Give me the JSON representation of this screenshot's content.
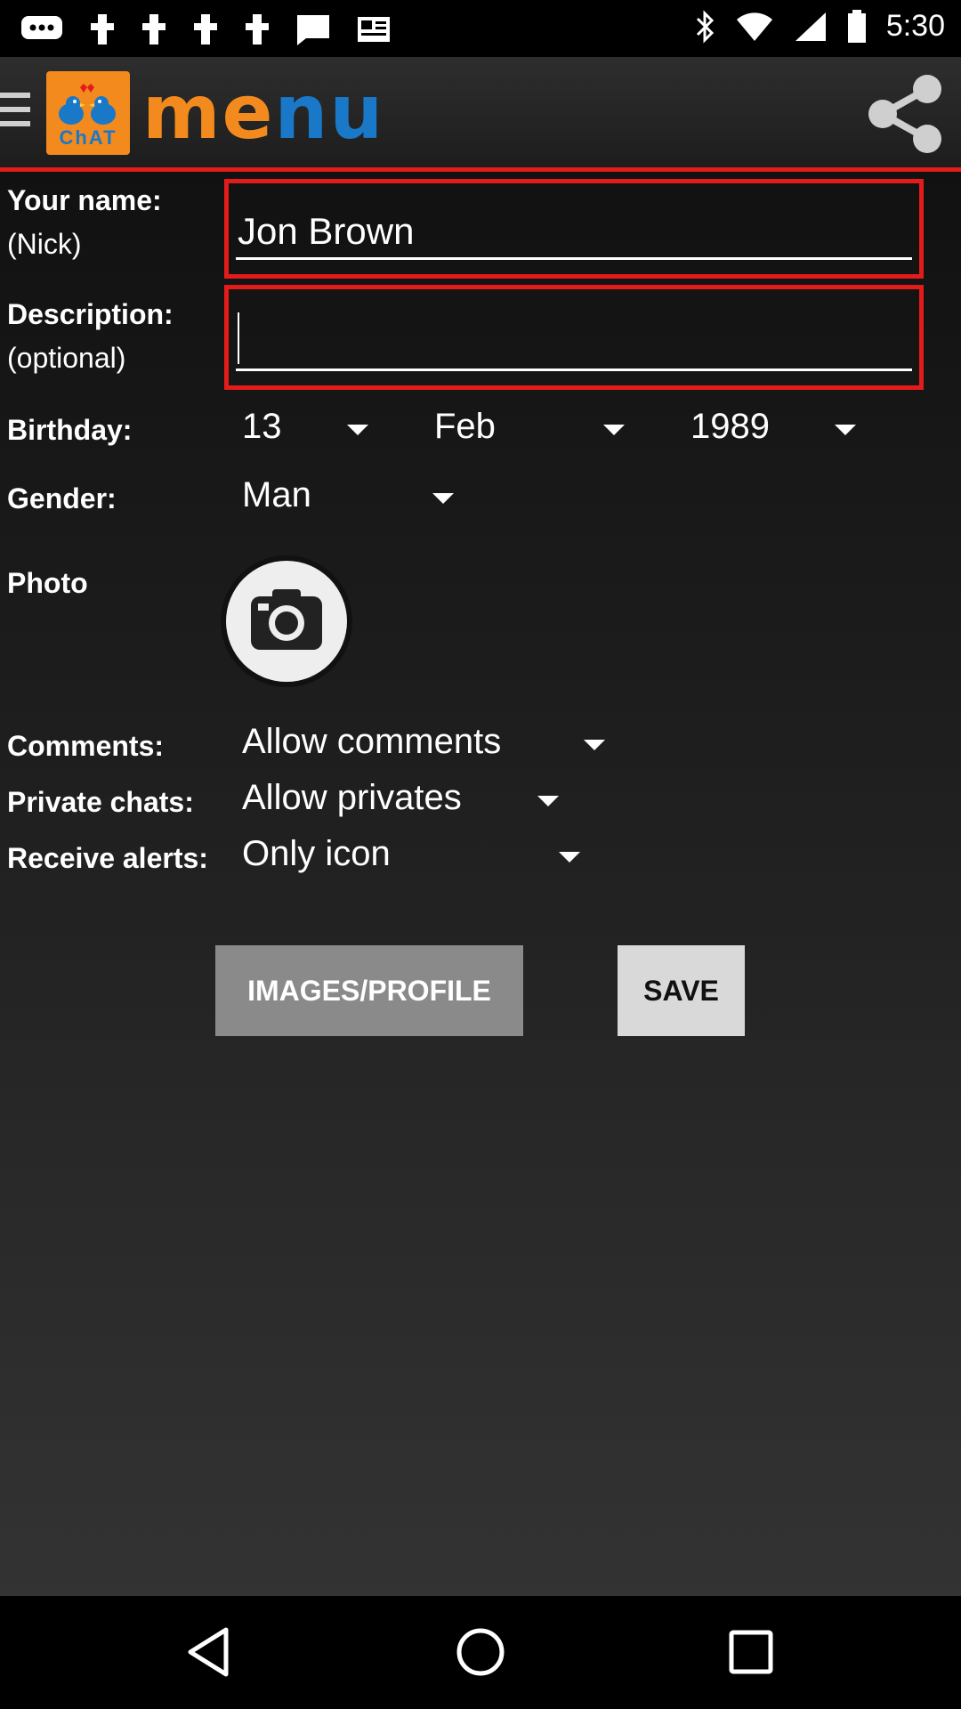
{
  "status_bar": {
    "time": "5:30",
    "icons": [
      "chat-bubble-icon",
      "notification-icon",
      "notification-icon",
      "notification-icon",
      "notification-icon",
      "message-icon",
      "newspaper-icon",
      "bluetooth-icon",
      "wifi-icon",
      "signal-icon",
      "battery-icon"
    ]
  },
  "app_bar": {
    "logo_text": "ChAT",
    "title_letters": [
      "m",
      "e",
      "n",
      "u"
    ]
  },
  "form": {
    "name_label": "Your name:",
    "name_sub": "(Nick)",
    "name_value": "Jon Brown",
    "description_label": "Description:",
    "description_sub": "(optional)",
    "description_value": "",
    "birthday_label": "Birthday:",
    "birthday_day": "13",
    "birthday_month": "Feb",
    "birthday_year": "1989",
    "gender_label": "Gender:",
    "gender_value": "Man",
    "photo_label": "Photo",
    "comments_label": "Comments:",
    "comments_value": "Allow comments",
    "private_label": "Private chats:",
    "private_value": "Allow privates",
    "alerts_label": "Receive alerts:",
    "alerts_value": "Only icon"
  },
  "buttons": {
    "images_profile": "IMAGES/PROFILE",
    "save": "SAVE"
  },
  "colors": {
    "accent_red": "#e31b1b",
    "logo_orange": "#f28a1e",
    "logo_blue": "#1a78c9"
  }
}
